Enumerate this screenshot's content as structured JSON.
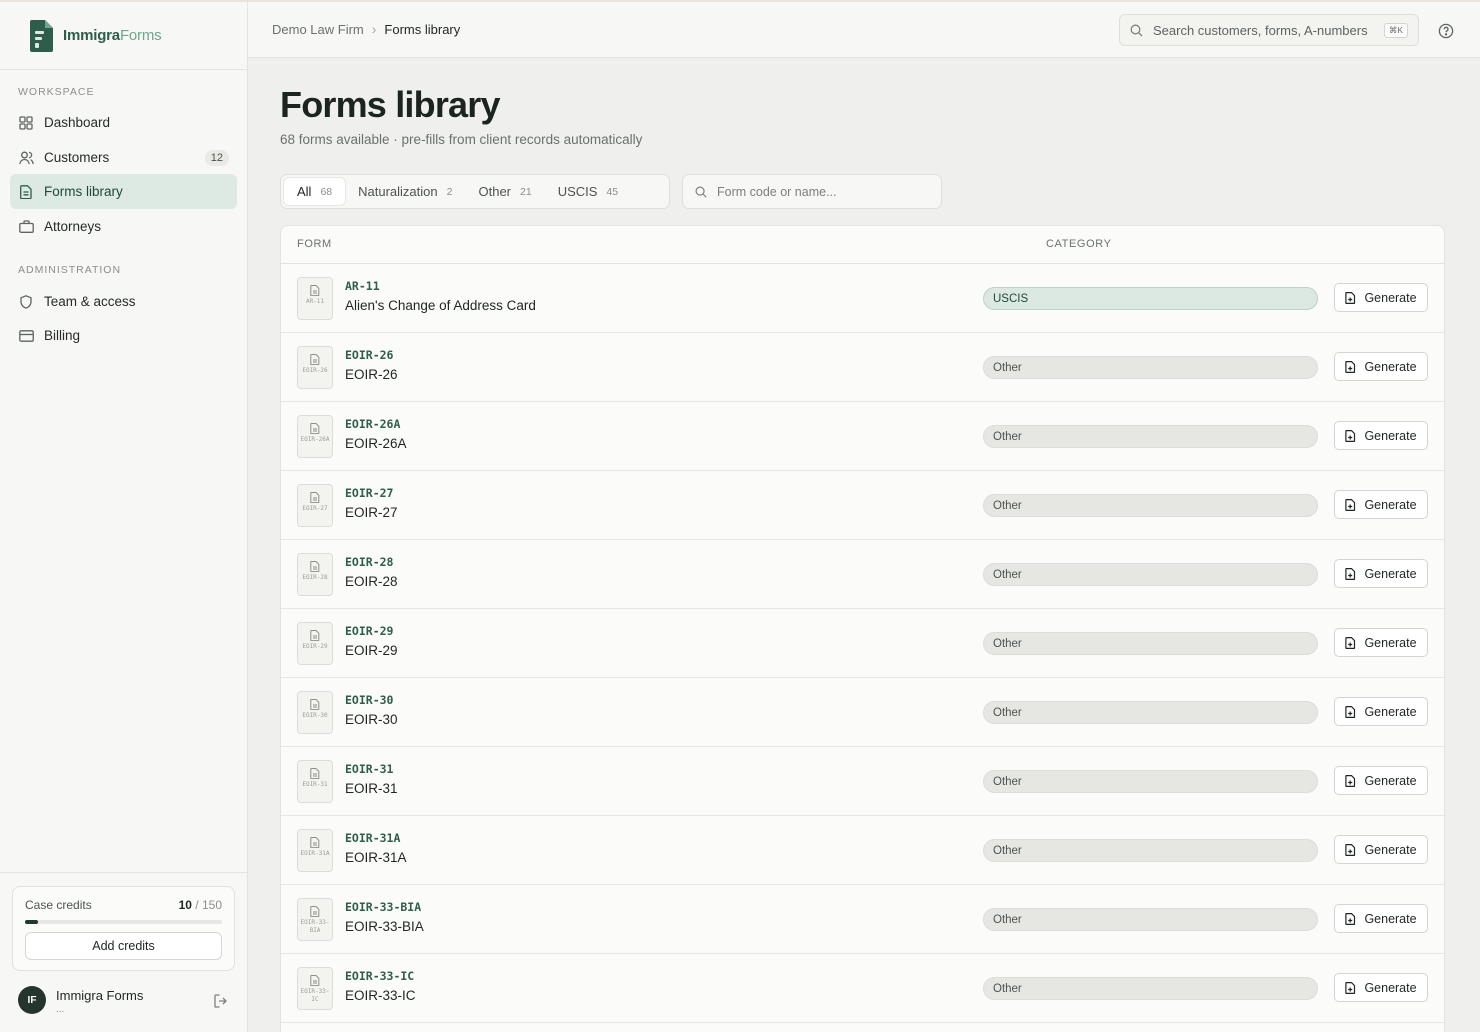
{
  "brand": {
    "name_bold": "Immigra",
    "name_light": "Forms"
  },
  "sidebar": {
    "workspace_label": "WORKSPACE",
    "admin_label": "ADMINISTRATION",
    "items": [
      {
        "label": "Dashboard",
        "icon": "grid-icon"
      },
      {
        "label": "Customers",
        "icon": "users-icon",
        "badge": "12"
      },
      {
        "label": "Forms library",
        "icon": "document-icon",
        "active": true
      },
      {
        "label": "Attorneys",
        "icon": "briefcase-icon"
      },
      {
        "label": "Team & access",
        "icon": "shield-icon"
      },
      {
        "label": "Billing",
        "icon": "credit-card-icon"
      }
    ],
    "credits": {
      "label": "Case credits",
      "used": "10",
      "total": "/ 150",
      "fraction": 0.0667,
      "button": "Add credits"
    },
    "user": {
      "initials": "IF",
      "name": "Immigra Forms",
      "sub": "..."
    }
  },
  "topbar": {
    "breadcrumb": {
      "parent": "Demo Law Firm",
      "current": "Forms library"
    },
    "search_placeholder": "Search customers, forms, A-numbers",
    "shortcut": "⌘K"
  },
  "page": {
    "title": "Forms library",
    "subtitle": "68 forms available · pre-fills from client records automatically",
    "tabs": [
      {
        "label": "All",
        "count": "68",
        "active": true
      },
      {
        "label": "Naturalization",
        "count": "2"
      },
      {
        "label": "Other",
        "count": "21"
      },
      {
        "label": "USCIS",
        "count": "45"
      }
    ],
    "filter_placeholder": "Form code or name..."
  },
  "table": {
    "col_form": "FORM",
    "col_category": "CATEGORY",
    "action_label": "Generate",
    "rows": [
      {
        "code": "AR-11",
        "icon_code": "AR-11",
        "name": "Alien's Change of Address Card",
        "category": "USCIS"
      },
      {
        "code": "EOIR-26",
        "icon_code": "EOIR-26",
        "name": "EOIR-26",
        "category": "Other"
      },
      {
        "code": "EOIR-26A",
        "icon_code": "EOIR-26A",
        "name": "EOIR-26A",
        "category": "Other"
      },
      {
        "code": "EOIR-27",
        "icon_code": "EOIR-27",
        "name": "EOIR-27",
        "category": "Other"
      },
      {
        "code": "EOIR-28",
        "icon_code": "EOIR-28",
        "name": "EOIR-28",
        "category": "Other"
      },
      {
        "code": "EOIR-29",
        "icon_code": "EOIR-29",
        "name": "EOIR-29",
        "category": "Other"
      },
      {
        "code": "EOIR-30",
        "icon_code": "EOIR-30",
        "name": "EOIR-30",
        "category": "Other"
      },
      {
        "code": "EOIR-31",
        "icon_code": "EOIR-31",
        "name": "EOIR-31",
        "category": "Other"
      },
      {
        "code": "EOIR-31A",
        "icon_code": "EOIR-31A",
        "name": "EOIR-31A",
        "category": "Other"
      },
      {
        "code": "EOIR-33-BIA",
        "icon_code": "EOIR-33-BIA",
        "name": "EOIR-33-BIA",
        "category": "Other"
      },
      {
        "code": "EOIR-33-IC",
        "icon_code": "EOIR-33-IC",
        "name": "EOIR-33-IC",
        "category": "Other"
      }
    ]
  },
  "colors": {
    "accent": "#2f5d4c",
    "active_bg": "#dde9e3",
    "uscis_bg": "#dce9e2"
  }
}
